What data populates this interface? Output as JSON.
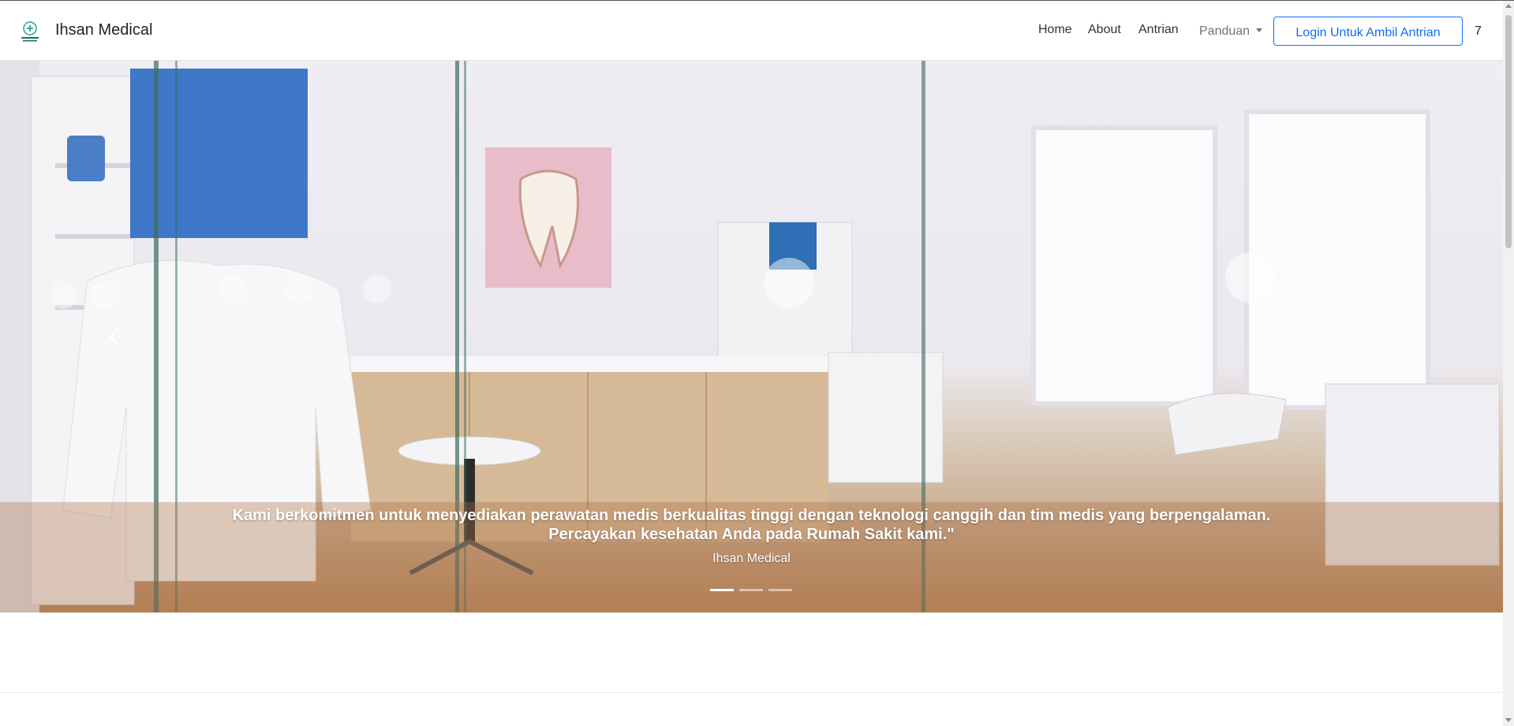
{
  "navbar": {
    "brand_name": "Ihsan Medical",
    "logo_icon": "medical-logo-icon",
    "links": [
      "Home",
      "About",
      "Antrian"
    ],
    "dropdown_label": "Panduan",
    "login_button": "Login Untuk Ambil Antrian",
    "count": "7"
  },
  "carousel": {
    "caption_line1": "Kami berkomitmen untuk menyediakan perawatan medis berkualitas tinggi dengan teknologi canggih dan tim medis yang berpengalaman.",
    "caption_line2": "Percayakan kesehatan Anda pada Rumah Sakit kami.\"",
    "caption_author": "Ihsan Medical",
    "slide_count": 3,
    "active_slide": 1,
    "prev_icon": "chevron-left-icon"
  },
  "colors": {
    "primary": "#0d6efd",
    "text": "#212529",
    "muted": "#6c757d"
  }
}
